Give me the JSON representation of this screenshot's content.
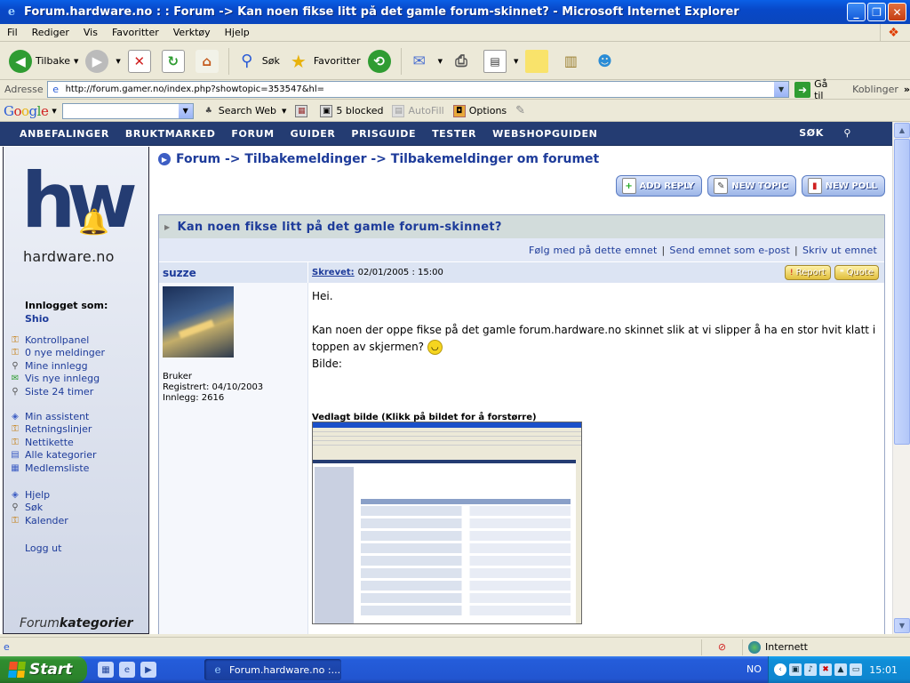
{
  "window": {
    "title": "Forum.hardware.no : : Forum -> Kan noen fikse litt på det gamle forum-skinnet? - Microsoft Internet Explorer"
  },
  "menubar": {
    "items": [
      "Fil",
      "Rediger",
      "Vis",
      "Favoritter",
      "Verktøy",
      "Hjelp"
    ]
  },
  "toolbar": {
    "back": "Tilbake",
    "search": "Søk",
    "favorites": "Favoritter"
  },
  "address": {
    "label": "Adresse",
    "url": "http://forum.gamer.no/index.php?showtopic=353547&hl=",
    "go": "Gå til",
    "links": "Koblinger"
  },
  "googlebar": {
    "logo": "Google",
    "search_web": "Search Web",
    "blocked": "5 blocked",
    "autofill": "AutoFill",
    "options": "Options"
  },
  "site_nav": {
    "items": [
      "ANBEFALINGER",
      "BRUKTMARKED",
      "FORUM",
      "GUIDER",
      "PRISGUIDE",
      "TESTER",
      "WEBSHOPGUIDEN"
    ],
    "search": "SØK"
  },
  "sidebar": {
    "logo_text": "hardware.no",
    "logged_in_label": "Innlogget som:",
    "username": "Shio",
    "group1": [
      "Kontrollpanel",
      "0 nye meldinger",
      "Mine innlegg",
      "Vis nye innlegg",
      "Siste 24 timer"
    ],
    "group2": [
      "Min assistent",
      "Retningslinjer",
      "Nettikette",
      "Alle kategorier",
      "Medlemsliste"
    ],
    "group3": [
      "Hjelp",
      "Søk",
      "Kalender"
    ],
    "logout": "Logg ut",
    "footer_a": "Forum",
    "footer_b": "kategorier"
  },
  "breadcrumb": {
    "text": "Forum -> Tilbakemeldinger -> Tilbakemeldinger om forumet"
  },
  "actions": {
    "add_reply": "ADD REPLY",
    "new_topic": "NEW TOPIC",
    "new_poll": "NEW POLL"
  },
  "topic": {
    "title": "Kan noen fikse litt på det gamle forum-skinnet?",
    "follow": "Følg med på dette emnet",
    "send_email": "Send emnet som e-post",
    "print": "Skriv ut emnet"
  },
  "post": {
    "author": "suzze",
    "written_label": "Skrevet:",
    "date": "02/01/2005 : 15:00",
    "report": "Report",
    "quote": "Quote",
    "rank": "Bruker",
    "registered": "Registrert: 04/10/2003",
    "posts": "Innlegg: 2616",
    "line1": "Hei.",
    "line2": "Kan noen der oppe fikse på det gamle forum.hardware.no skinnet slik at vi slipper å ha en stor hvit klatt i toppen av skjermen?",
    "line3": "Bilde:",
    "attachment_label": "Vedlagt bilde (Klikk på bildet for å forstørre)"
  },
  "statusbar": {
    "zone": "Internett"
  },
  "taskbar": {
    "start": "Start",
    "task": "Forum.hardware.no :...",
    "lang": "NO",
    "clock": "15:01"
  }
}
